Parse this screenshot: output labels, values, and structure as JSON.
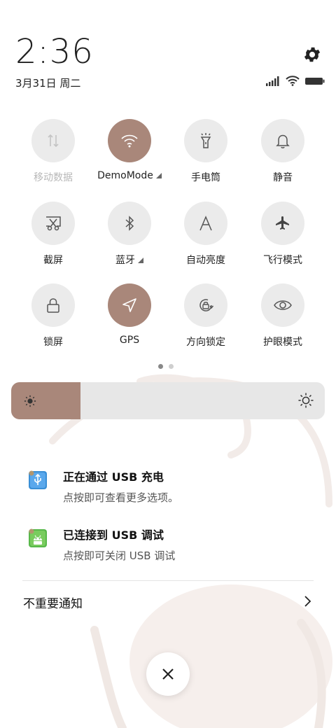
{
  "status": {
    "time": "2:36",
    "date": "3月31日 周二"
  },
  "tiles": [
    {
      "label": "移动数据",
      "icon": "mobile-data-icon",
      "active": false,
      "disabled": true
    },
    {
      "label": "DemoMode",
      "icon": "wifi-icon",
      "active": true,
      "has_expand": true
    },
    {
      "label": "手电筒",
      "icon": "flashlight-icon",
      "active": false
    },
    {
      "label": "静音",
      "icon": "bell-icon",
      "active": false
    },
    {
      "label": "截屏",
      "icon": "screenshot-icon",
      "active": false
    },
    {
      "label": "蓝牙",
      "icon": "bluetooth-icon",
      "active": false,
      "has_expand": true
    },
    {
      "label": "自动亮度",
      "icon": "auto-brightness-icon",
      "active": false
    },
    {
      "label": "飞行模式",
      "icon": "airplane-icon",
      "active": false
    },
    {
      "label": "锁屏",
      "icon": "lock-icon",
      "active": false
    },
    {
      "label": "GPS",
      "icon": "location-arrow-icon",
      "active": true
    },
    {
      "label": "方向锁定",
      "icon": "rotation-lock-icon",
      "active": false
    },
    {
      "label": "护眼模式",
      "icon": "eye-icon",
      "active": false
    }
  ],
  "pager": {
    "pages": 2,
    "current": 1
  },
  "brightness": {
    "level": 0.22
  },
  "notifications": [
    {
      "title": "正在通过 USB 充电",
      "body": "点按即可查看更多选项。",
      "icon": "usb-icon"
    },
    {
      "title": "已连接到 USB 调试",
      "body": "点按即可关闭 USB 调试",
      "icon": "android-debug-icon"
    }
  ],
  "unimportant_label": "不重要通知",
  "colors": {
    "accent": "#a9877a",
    "tile_bg": "#ebebeb",
    "slider_bg": "#e7e7e7"
  }
}
